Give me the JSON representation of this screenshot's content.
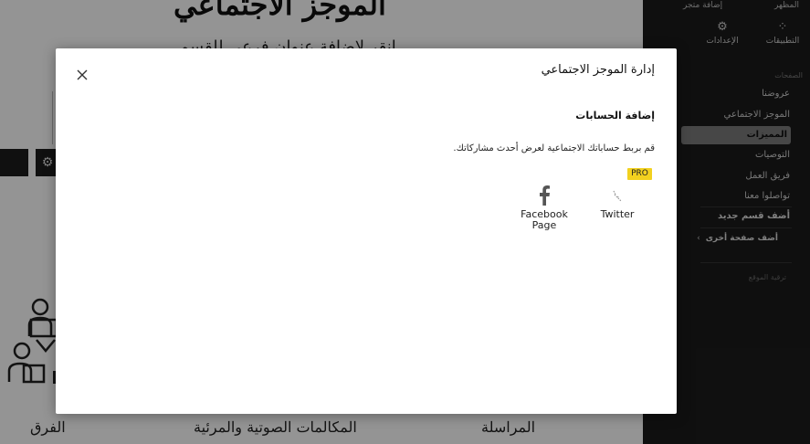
{
  "background_page": {
    "title": "الموجز الاجتماعي",
    "subtitle": "انقر لإضافة عنوان فرعي للقسم",
    "captions": [
      "المراسلة",
      "المكالمات الصوتية والمرئية",
      "الفرق"
    ]
  },
  "sidebar": {
    "topbar": {
      "left": "إضافة متجر",
      "right": "المظهر"
    },
    "tools": [
      {
        "label": "التطبيقات",
        "icon": "apps-icon"
      },
      {
        "label": "الإعدادات",
        "icon": "gear-icon"
      }
    ],
    "section_label": "الصفحات",
    "items": [
      {
        "label": "عروضنا",
        "active": false
      },
      {
        "label": "الموجز الاجتماعي",
        "active": false
      },
      {
        "label": "المميزات",
        "active": true
      },
      {
        "label": "التوصيات",
        "active": false
      },
      {
        "label": "فريق العمل",
        "active": false
      },
      {
        "label": "تواصلوا معنا",
        "active": false
      }
    ],
    "add_section": "أضف قسم جديد",
    "add_page": "أضف صفحة أخرى",
    "footer_text": "ترقية الموقع"
  },
  "modal": {
    "title": "إدارة الموجز الاجتماعي",
    "section_title": "إضافة الحسابات",
    "description": "قم بربط حساباتك الاجتماعية لعرض أحدث مشاركاتك.",
    "pro_badge": "PRO",
    "accounts": [
      {
        "label": "Twitter",
        "icon": "twitter-icon",
        "pro": true
      },
      {
        "label": "Facebook Page",
        "icon": "facebook-icon",
        "pro": false
      }
    ]
  },
  "colors": {
    "sidebar_bg": "#1b1b1b",
    "pro_badge": "#f2d11f",
    "active_item": "#7b7b7b"
  }
}
